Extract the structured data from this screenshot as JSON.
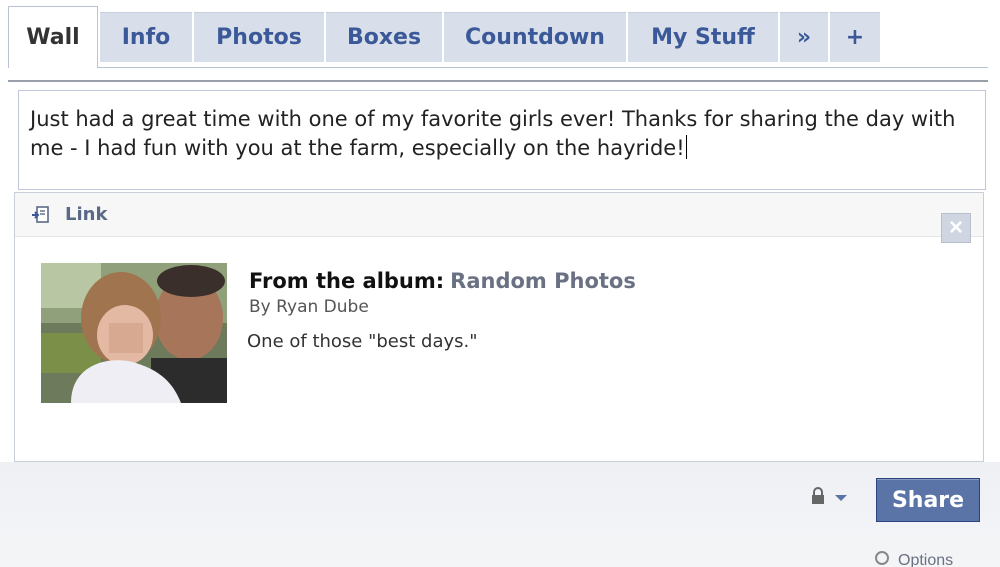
{
  "tabs": [
    {
      "label": "Wall",
      "active": true
    },
    {
      "label": "Info"
    },
    {
      "label": "Photos"
    },
    {
      "label": "Boxes"
    },
    {
      "label": "Countdown"
    },
    {
      "label": "My Stuff"
    },
    {
      "label": "»"
    },
    {
      "label": "+"
    }
  ],
  "status": {
    "text": "Just had a great time with one of my favorite girls ever! Thanks for sharing the day with me - I had fun with you at the farm, especially on the hayride!"
  },
  "attachment": {
    "header_label": "Link",
    "close_label": "×",
    "album_prefix": "From the album:",
    "album_name": "Random Photos",
    "byline": "By Ryan Dube",
    "description": "One of those \"best days.\"",
    "icons": {
      "link": "link-icon",
      "close": "close-icon"
    }
  },
  "footer": {
    "privacy_icon": "lock-icon",
    "share_label": "Share",
    "options_label": "Options"
  },
  "colors": {
    "brand": "#3b5998",
    "tab_bg": "#d8dfea",
    "button": "#5b74a8"
  }
}
